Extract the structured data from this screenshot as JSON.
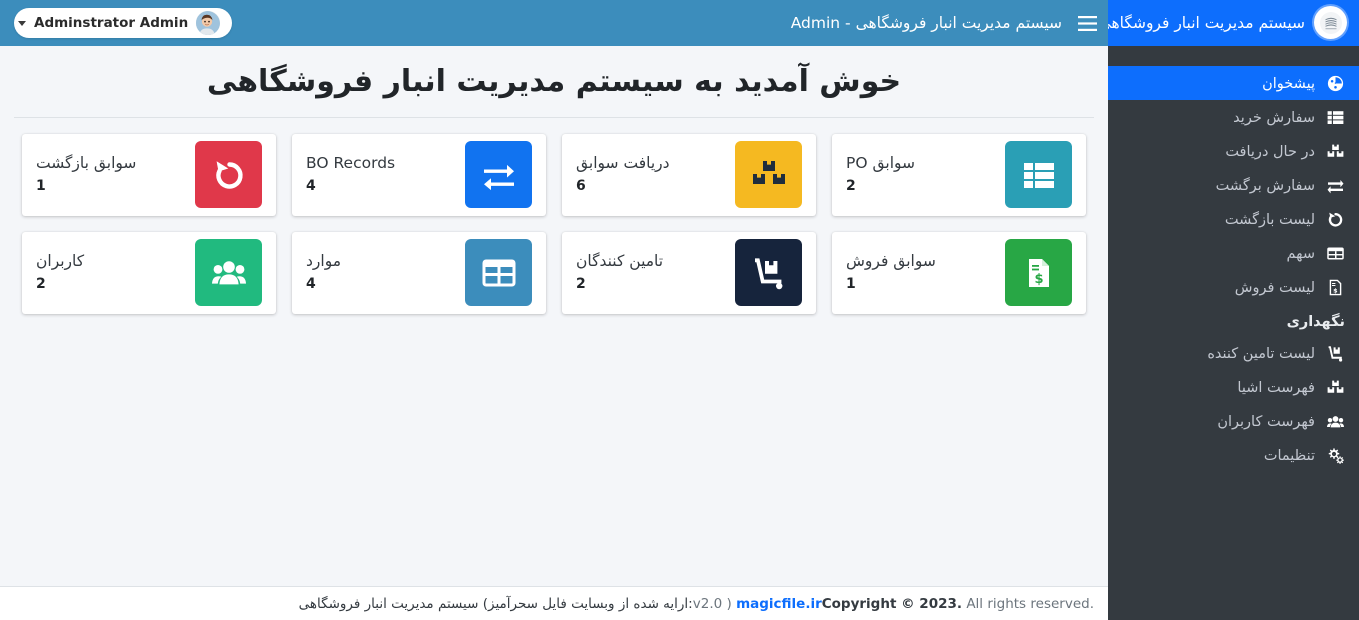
{
  "brand": {
    "title": "سیستم مدیریت انبار فروشگاهی",
    "logo_icon": "warehouse-logo-icon"
  },
  "topbar": {
    "menu_icon": "hamburger-menu-icon",
    "title": "سیستم مدیریت انبار فروشگاهی - Admin",
    "background_color": "#3c8dbc",
    "user": {
      "name": "Adminstrator Admin",
      "avatar_icon": "user-avatar",
      "caret_icon": "chevron-down-icon"
    }
  },
  "sidebar": {
    "background_color": "#343a40",
    "active_color": "#0d6efd",
    "items": [
      {
        "label": "پیشخوان",
        "icon": "dashboard-gauge-icon",
        "active": true
      },
      {
        "label": "سفارش خرید",
        "icon": "list-table-icon",
        "active": false
      },
      {
        "label": "در حال دریافت",
        "icon": "boxes-icon",
        "active": false
      },
      {
        "label": "سفارش برگشت",
        "icon": "exchange-arrows-icon",
        "active": false
      },
      {
        "label": "لیست بازگشت",
        "icon": "undo-arrow-icon",
        "active": false
      },
      {
        "label": "سهم",
        "icon": "grid-table-icon",
        "active": false
      },
      {
        "label": "لیست فروش",
        "icon": "invoice-dollar-icon",
        "active": false
      }
    ],
    "section_header": "نگهداری",
    "section_items": [
      {
        "label": "لیست تامین کننده",
        "icon": "dolly-icon"
      },
      {
        "label": "فهرست اشیا",
        "icon": "boxes-icon"
      },
      {
        "label": "فهرست کاربران",
        "icon": "users-icon"
      },
      {
        "label": "تنظیمات",
        "icon": "gears-icon"
      }
    ]
  },
  "main": {
    "page_title": "خوش آمدید به سیستم مدیریت انبار فروشگاهی",
    "cards": [
      {
        "label": "سوابق PO",
        "value": "2",
        "icon": "list-table-icon",
        "color": "#2a9fb5"
      },
      {
        "label": "دریافت سوابق",
        "value": "6",
        "icon": "boxes-icon",
        "color": "#f5b921",
        "icon_color": "#1f2d3d"
      },
      {
        "label": "BO Records",
        "value": "4",
        "icon": "exchange-arrows-icon",
        "color": "#1173f0"
      },
      {
        "label": "سوابق بازگشت",
        "value": "1",
        "icon": "undo-arrow-icon",
        "color": "#e0384a"
      },
      {
        "label": "سوابق فروش",
        "value": "1",
        "icon": "invoice-dollar-icon",
        "color": "#28a745"
      },
      {
        "label": "تامین کنندگان",
        "value": "2",
        "icon": "dolly-icon",
        "color": "#16243c"
      },
      {
        "label": "موارد",
        "value": "4",
        "icon": "grid-table-icon",
        "color": "#3c8dbc"
      },
      {
        "label": "کاربران",
        "value": "2",
        "icon": "users-icon",
        "color": "#21ba7f"
      }
    ]
  },
  "footer": {
    "right_text_before": "v2.0 )",
    "right_link": "magicfile.ir",
    "right_text_after": ":ارایه شده از وبسایت فایل سحرآمیز) سیستم مدیریت انبار فروشگاهی",
    "left_bold": "Copyright © 2023.",
    "left_rest": "All rights reserved."
  }
}
